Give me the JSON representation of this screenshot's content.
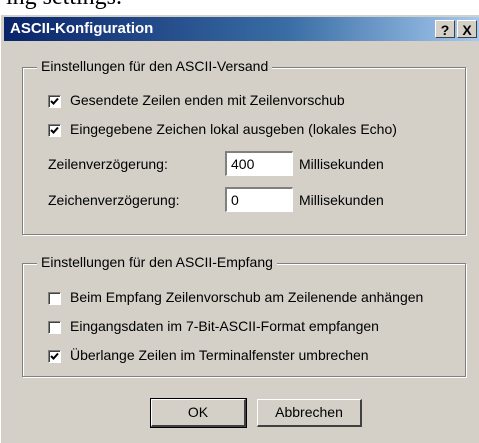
{
  "background_text": "ing settings.",
  "window": {
    "title": "ASCII-Konfiguration",
    "help_button": "?",
    "close_button": "X"
  },
  "send_group": {
    "label": "Einstellungen für den ASCII-Versand",
    "options": [
      {
        "label": "Gesendete Zeilen enden mit Zeilenvorschub",
        "checked": true
      },
      {
        "label": "Eingegebene Zeichen lokal ausgeben (lokales Echo)",
        "checked": true
      }
    ],
    "line_delay": {
      "label": "Zeilenverzögerung:",
      "value": "400",
      "unit": "Millisekunden"
    },
    "char_delay": {
      "label": "Zeichenverzögerung:",
      "value": "0",
      "unit": "Millisekunden"
    }
  },
  "receive_group": {
    "label": "Einstellungen für den ASCII-Empfang",
    "options": [
      {
        "label": "Beim Empfang Zeilenvorschub am Zeilenende anhängen",
        "checked": false
      },
      {
        "label": "Eingangsdaten im 7-Bit-ASCII-Format empfangen",
        "checked": false
      },
      {
        "label": "Überlange Zeilen im Terminalfenster umbrechen",
        "checked": true
      }
    ]
  },
  "buttons": {
    "ok": "OK",
    "cancel": "Abbrechen"
  }
}
